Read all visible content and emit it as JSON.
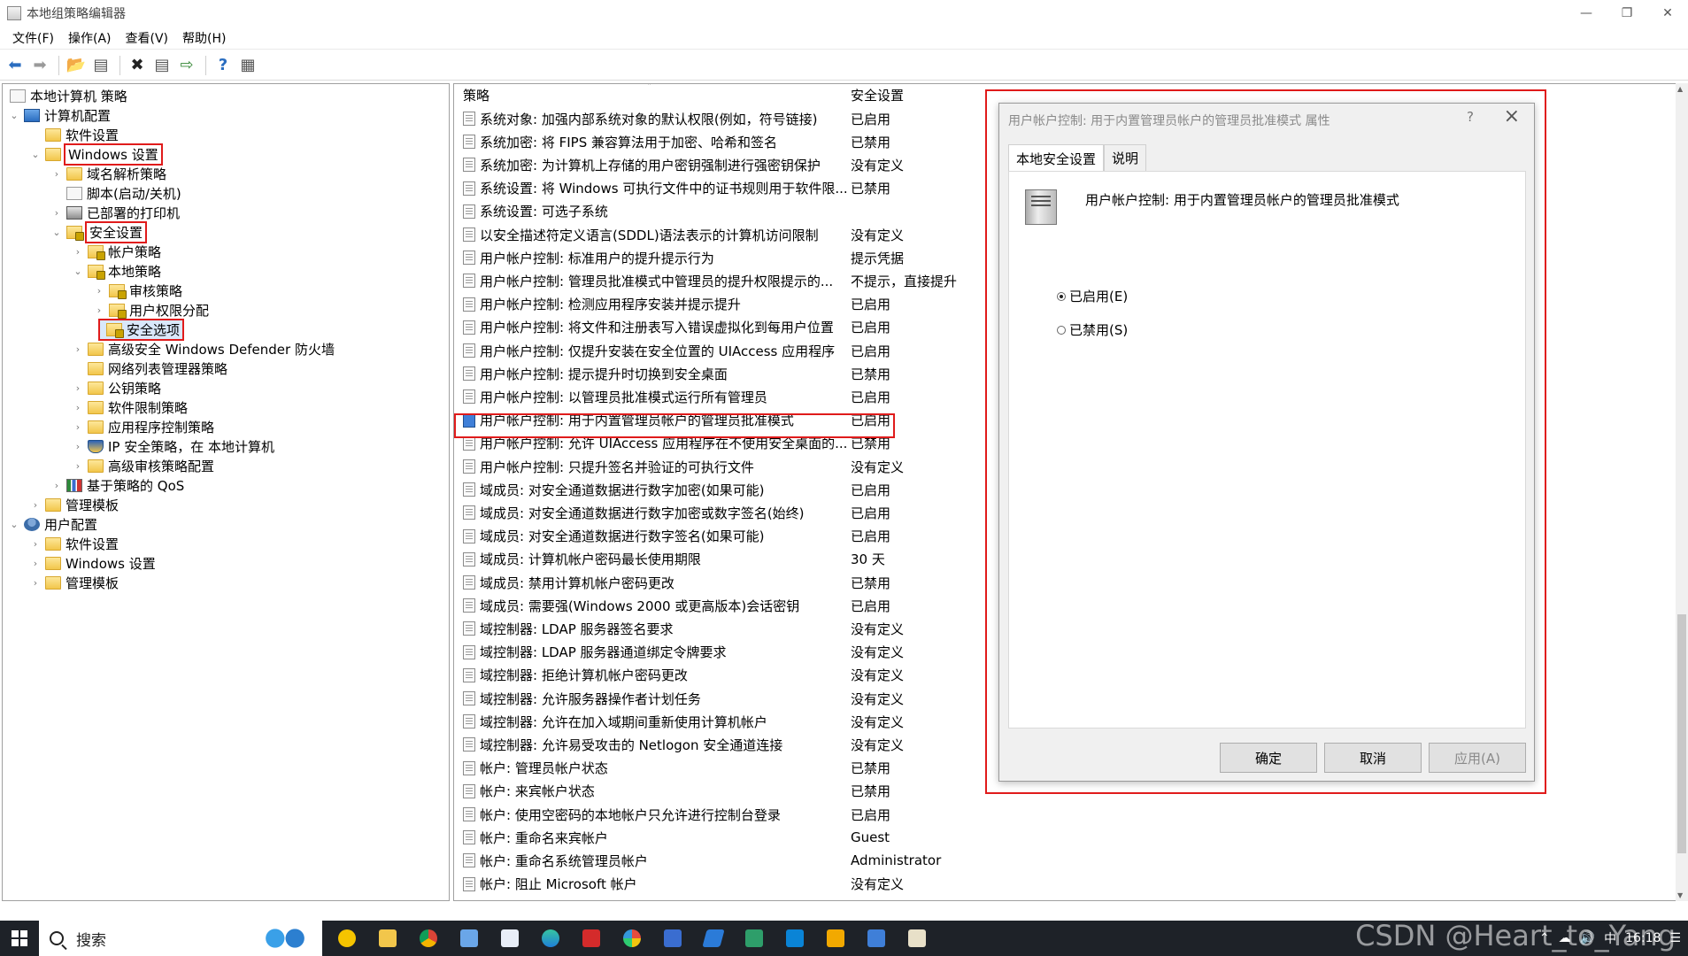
{
  "window": {
    "title": "本地组策略编辑器"
  },
  "menu": [
    "文件(F)",
    "操作(A)",
    "查看(V)",
    "帮助(H)"
  ],
  "tree": {
    "root": "本地计算机 策略",
    "items": [
      {
        "label": "计算机配置"
      },
      {
        "label": "软件设置"
      },
      {
        "label": "Windows 设置"
      },
      {
        "label": "域名解析策略"
      },
      {
        "label": "脚本(启动/关机)"
      },
      {
        "label": "已部署的打印机"
      },
      {
        "label": "安全设置"
      },
      {
        "label": "帐户策略"
      },
      {
        "label": "本地策略"
      },
      {
        "label": "审核策略"
      },
      {
        "label": "用户权限分配"
      },
      {
        "label": "安全选项"
      },
      {
        "label": "高级安全 Windows Defender 防火墙"
      },
      {
        "label": "网络列表管理器策略"
      },
      {
        "label": "公钥策略"
      },
      {
        "label": "软件限制策略"
      },
      {
        "label": "应用程序控制策略"
      },
      {
        "label": "IP 安全策略，在 本地计算机"
      },
      {
        "label": "高级审核策略配置"
      },
      {
        "label": "基于策略的 QoS"
      },
      {
        "label": "管理模板"
      },
      {
        "label": "用户配置"
      },
      {
        "label": "软件设置"
      },
      {
        "label": "Windows 设置"
      },
      {
        "label": "管理模板"
      }
    ]
  },
  "list": {
    "col_policy": "策略",
    "col_setting": "安全设置",
    "rows": [
      {
        "name": "系统对象: 加强内部系统对象的默认权限(例如，符号链接)",
        "value": "已启用"
      },
      {
        "name": "系统加密: 将 FIPS 兼容算法用于加密、哈希和签名",
        "value": "已禁用"
      },
      {
        "name": "系统加密: 为计算机上存储的用户密钥强制进行强密钥保护",
        "value": "没有定义"
      },
      {
        "name": "系统设置: 将 Windows 可执行文件中的证书规则用于软件限...",
        "value": "已禁用"
      },
      {
        "name": "系统设置: 可选子系统",
        "value": ""
      },
      {
        "name": "以安全描述符定义语言(SDDL)语法表示的计算机访问限制",
        "value": "没有定义"
      },
      {
        "name": "用户帐户控制: 标准用户的提升提示行为",
        "value": "提示凭据"
      },
      {
        "name": "用户帐户控制: 管理员批准模式中管理员的提升权限提示的...",
        "value": "不提示，直接提升"
      },
      {
        "name": "用户帐户控制: 检测应用程序安装并提示提升",
        "value": "已启用"
      },
      {
        "name": "用户帐户控制: 将文件和注册表写入错误虚拟化到每用户位置",
        "value": "已启用"
      },
      {
        "name": "用户帐户控制: 仅提升安装在安全位置的 UIAccess 应用程序",
        "value": "已启用"
      },
      {
        "name": "用户帐户控制: 提示提升时切换到安全桌面",
        "value": "已禁用"
      },
      {
        "name": "用户帐户控制: 以管理员批准模式运行所有管理员",
        "value": "已启用"
      },
      {
        "name": "用户帐户控制: 用于内置管理员帐户的管理员批准模式",
        "value": "已启用"
      },
      {
        "name": "用户帐户控制: 允许 UIAccess 应用程序在不使用安全桌面的...",
        "value": "已禁用"
      },
      {
        "name": "用户帐户控制: 只提升签名并验证的可执行文件",
        "value": "没有定义"
      },
      {
        "name": "域成员: 对安全通道数据进行数字加密(如果可能)",
        "value": "已启用"
      },
      {
        "name": "域成员: 对安全通道数据进行数字加密或数字签名(始终)",
        "value": "已启用"
      },
      {
        "name": "域成员: 对安全通道数据进行数字签名(如果可能)",
        "value": "已启用"
      },
      {
        "name": "域成员: 计算机帐户密码最长使用期限",
        "value": "30 天"
      },
      {
        "name": "域成员: 禁用计算机帐户密码更改",
        "value": "已禁用"
      },
      {
        "name": "域成员: 需要强(Windows 2000 或更高版本)会话密钥",
        "value": "已启用"
      },
      {
        "name": "域控制器: LDAP 服务器签名要求",
        "value": "没有定义"
      },
      {
        "name": "域控制器: LDAP 服务器通道绑定令牌要求",
        "value": "没有定义"
      },
      {
        "name": "域控制器: 拒绝计算机帐户密码更改",
        "value": "没有定义"
      },
      {
        "name": "域控制器: 允许服务器操作者计划任务",
        "value": "没有定义"
      },
      {
        "name": "域控制器:  允许在加入域期间重新使用计算机帐户",
        "value": "没有定义"
      },
      {
        "name": "域控制器:  允许易受攻击的 Netlogon 安全通道连接",
        "value": "没有定义"
      },
      {
        "name": "帐户: 管理员帐户状态",
        "value": "已禁用"
      },
      {
        "name": "帐户: 来宾帐户状态",
        "value": "已禁用"
      },
      {
        "name": "帐户: 使用空密码的本地帐户只允许进行控制台登录",
        "value": "已启用"
      },
      {
        "name": "帐户: 重命名来宾帐户",
        "value": "Guest"
      },
      {
        "name": "帐户: 重命名系统管理员帐户",
        "value": "Administrator"
      },
      {
        "name": "帐户: 阻止 Microsoft 帐户",
        "value": "没有定义"
      }
    ]
  },
  "dialog": {
    "title": "用户帐户控制: 用于内置管理员帐户的管理员批准模式 属性",
    "help": "?",
    "tab_local": "本地安全设置",
    "tab_explain": "说明",
    "policy_title": "用户帐户控制: 用于内置管理员帐户的管理员批准模式",
    "radio_enabled": "已启用(E)",
    "radio_disabled": "已禁用(S)",
    "selected": "enabled",
    "ok": "确定",
    "cancel": "取消",
    "apply": "应用(A)"
  },
  "taskbar": {
    "search_label": "搜索",
    "ime": "中",
    "time": "16:18"
  },
  "watermark": "CSDN @Heart_to_Yang"
}
